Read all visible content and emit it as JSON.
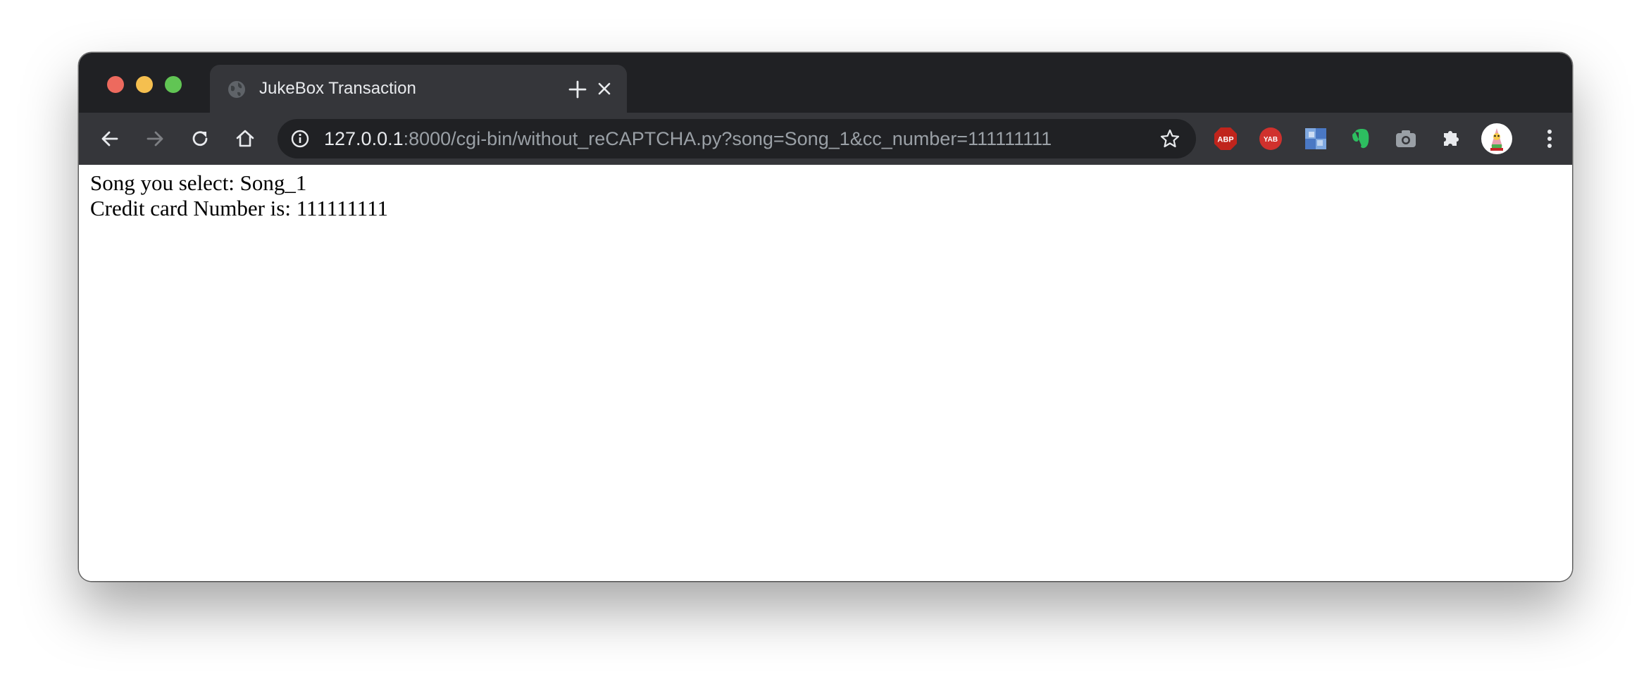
{
  "window": {
    "controls": [
      "close",
      "minimize",
      "maximize"
    ]
  },
  "tab": {
    "title": "JukeBox Transaction",
    "favicon": "globe-icon",
    "close_icon": "close-icon"
  },
  "new_tab_icon": "plus-icon",
  "toolbar": {
    "back_icon": "arrow-left-icon",
    "forward_icon": "arrow-right-icon",
    "reload_icon": "reload-icon",
    "home_icon": "home-icon",
    "url_host": "127.0.0.1",
    "url_rest": ":8000/cgi-bin/without_reCAPTCHA.py?song=Song_1&cc_number=111111111",
    "info_icon": "info-icon",
    "bookmark_icon": "star-icon",
    "extensions": {
      "abp_label": "ABP",
      "yab_label": "YAB"
    },
    "menu_icon": "kebab-menu-icon"
  },
  "page": {
    "line1": "Song you select: Song_1",
    "line2": "Credit card Number is: 111111111"
  },
  "colors": {
    "titlebar": "#202124",
    "toolbar": "#35363a",
    "close": "#ed6a5e",
    "minimize": "#f5bf4f",
    "maximize": "#61c554",
    "abp": "#c0241c",
    "yab": "#d0312d",
    "evernote": "#2dbe60"
  }
}
